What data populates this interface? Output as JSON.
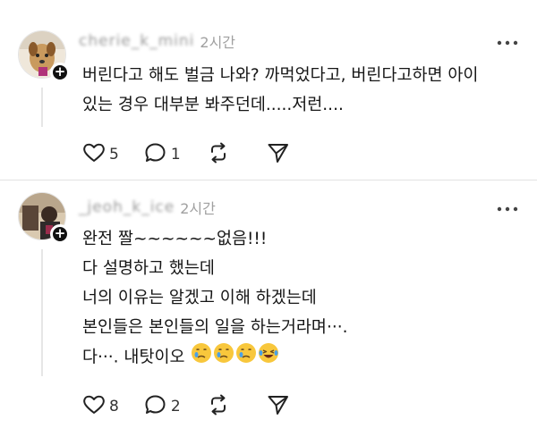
{
  "comments": [
    {
      "username": "cherie_k_mini",
      "time": "2시간",
      "text": "버린다고 해도 벌금 나와? 까먹었다고, 버린다고하면 아이\n있는 경우 대부분 봐주던데.....저런....",
      "likes": "5",
      "replies": "1",
      "avatar_icon": "dog-photo-avatar"
    },
    {
      "username": "_jeoh_k_ice",
      "time": "2시간",
      "text": "완전 짤~~~~~~없음!!!\n다 설명하고 했는데\n너의 이유는 알겠고 이해 하겠는데\n본인들은 본인들의 일을 하는거라며···.",
      "last_line": "다···. 내탓이오",
      "emojis": [
        "crying-face",
        "crying-face",
        "crying-face",
        "laughing-tears-face"
      ],
      "likes": "8",
      "replies": "2",
      "avatar_icon": "person-photo-avatar"
    }
  ],
  "icons": {
    "like": "heart-icon",
    "reply": "speech-bubble-icon",
    "repost": "repost-icon",
    "share": "send-icon",
    "more": "more-dots-icon",
    "follow": "plus-icon"
  },
  "colors": {
    "text": "#151515",
    "muted": "#a0a0a0",
    "divider": "#e2e2e2"
  }
}
